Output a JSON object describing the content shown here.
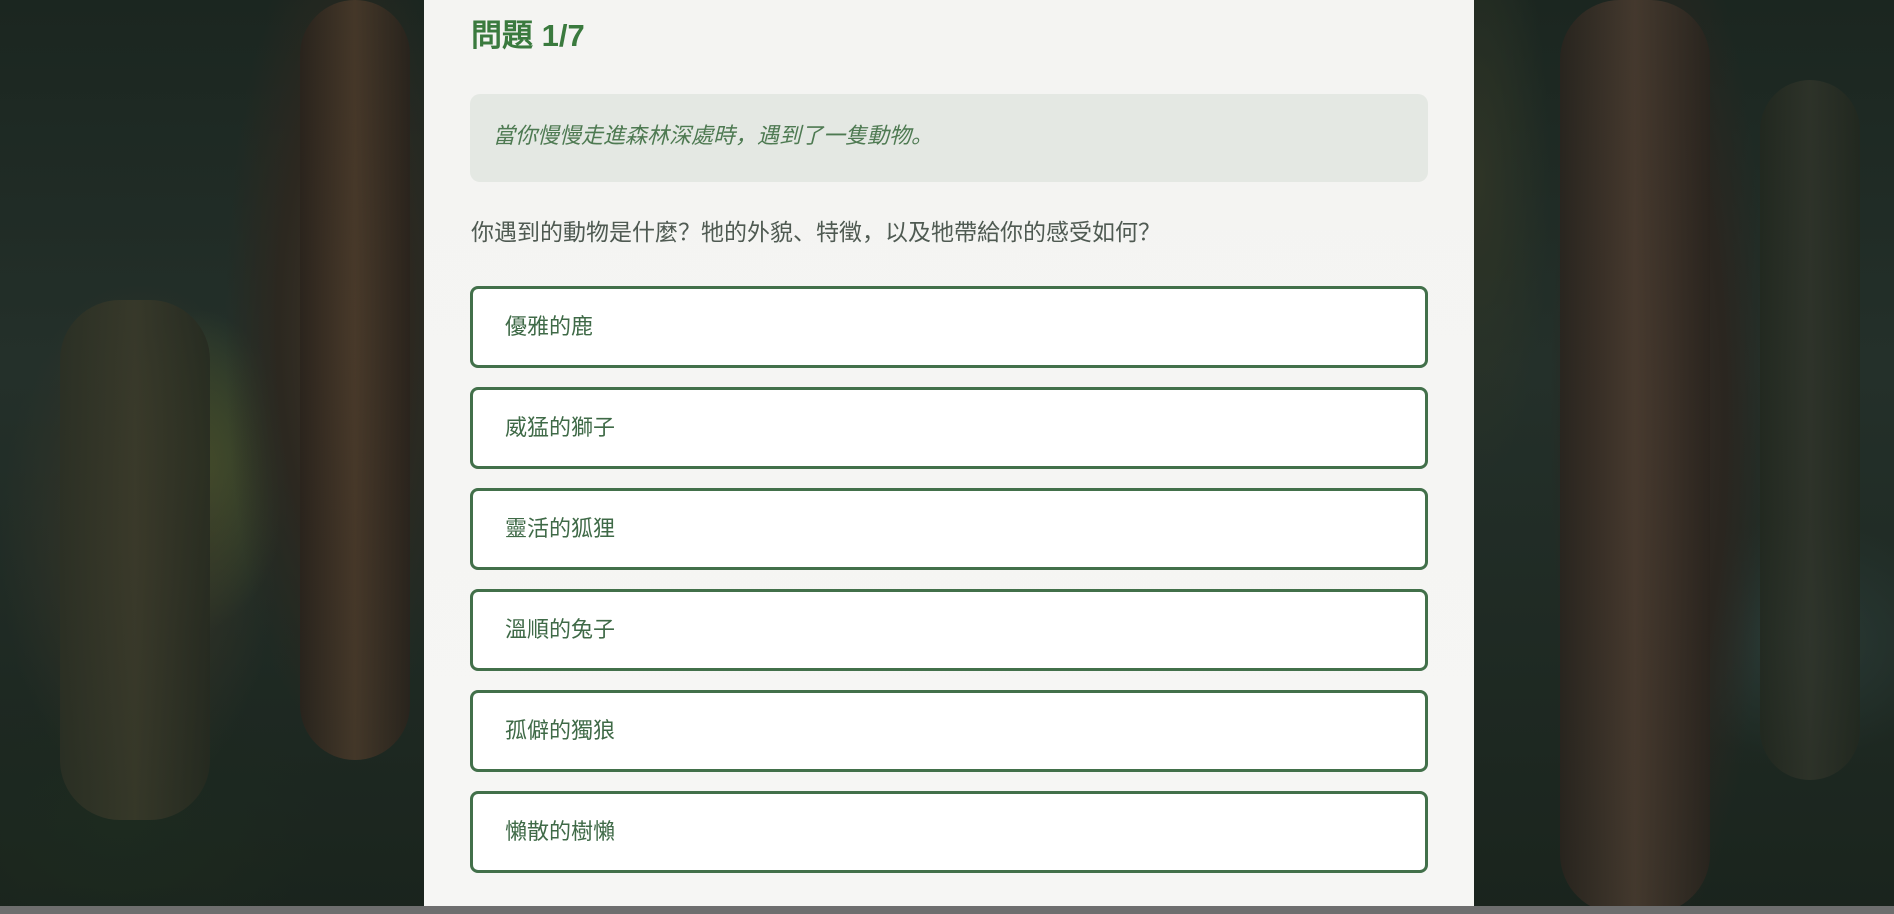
{
  "quiz": {
    "title": "問題 1/7",
    "scenario": "當你慢慢走進森林深處時，遇到了一隻動物。",
    "question": "你遇到的動物是什麼？牠的外貌、特徵，以及牠帶給你的感受如何？",
    "options": [
      {
        "label": "優雅的鹿"
      },
      {
        "label": "威猛的獅子"
      },
      {
        "label": "靈活的狐狸"
      },
      {
        "label": "溫順的兔子"
      },
      {
        "label": "孤僻的獨狼"
      },
      {
        "label": "懶散的樹懶"
      }
    ]
  },
  "colors": {
    "accent": "#3a7a3e",
    "option_border": "#42704a",
    "scenario_bg": "#e4e8e3",
    "panel_bg": "#f4f4f2"
  }
}
